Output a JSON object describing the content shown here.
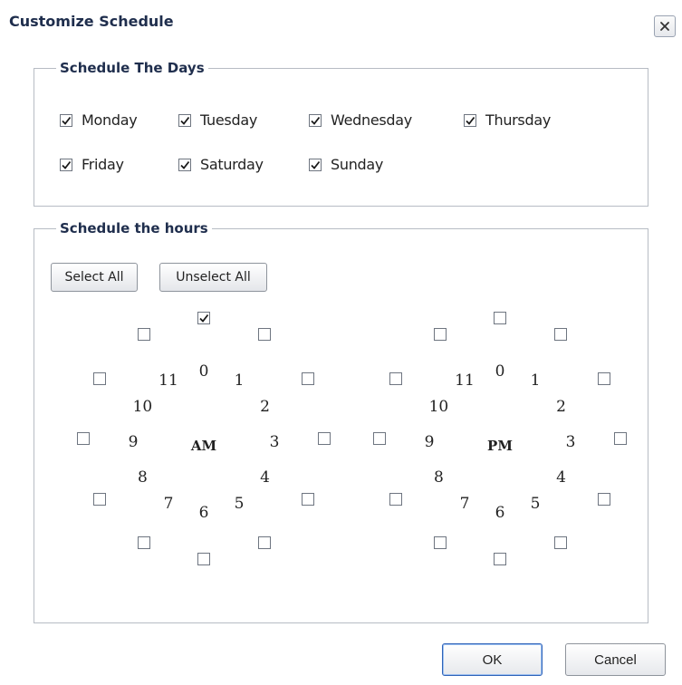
{
  "dialog": {
    "title": "Customize Schedule",
    "close_label": "×"
  },
  "days_section": {
    "legend": "Schedule The Days",
    "days": [
      {
        "label": "Monday",
        "checked": true
      },
      {
        "label": "Tuesday",
        "checked": true
      },
      {
        "label": "Wednesday",
        "checked": true
      },
      {
        "label": "Thursday",
        "checked": true
      },
      {
        "label": "Friday",
        "checked": true
      },
      {
        "label": "Saturday",
        "checked": true
      },
      {
        "label": "Sunday",
        "checked": true
      }
    ]
  },
  "hours_section": {
    "legend": "Schedule the hours",
    "select_all_label": "Select All",
    "unselect_all_label": "Unselect All",
    "clocks": [
      {
        "period": "AM",
        "hours": [
          "0",
          "1",
          "2",
          "3",
          "4",
          "5",
          "6",
          "7",
          "8",
          "9",
          "10",
          "11"
        ],
        "checked": [
          true,
          false,
          false,
          false,
          false,
          false,
          false,
          false,
          false,
          false,
          false,
          false
        ]
      },
      {
        "period": "PM",
        "hours": [
          "0",
          "1",
          "2",
          "3",
          "4",
          "5",
          "6",
          "7",
          "8",
          "9",
          "10",
          "11"
        ],
        "checked": [
          false,
          false,
          false,
          false,
          false,
          false,
          false,
          false,
          false,
          false,
          false,
          false
        ]
      }
    ]
  },
  "footer": {
    "ok_label": "OK",
    "cancel_label": "Cancel"
  },
  "colors": {
    "title_text": "#1f2e4d",
    "group_border": "#b7bcc4",
    "default_button_border": "#2f63b8"
  }
}
